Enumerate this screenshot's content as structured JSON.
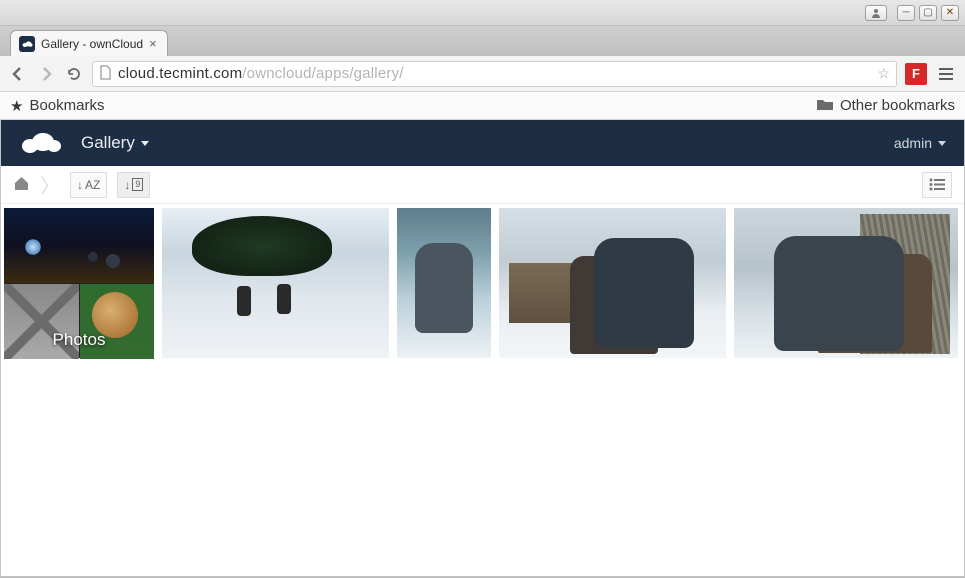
{
  "window": {
    "tab_title": "Gallery - ownCloud"
  },
  "browser": {
    "url_host": "cloud.tecmint.com",
    "url_path": "/owncloud/apps/gallery/",
    "bookmarks_label": "Bookmarks",
    "other_bookmarks_label": "Other bookmarks",
    "extension_letter": "F"
  },
  "owncloud": {
    "app_name": "Gallery",
    "user_name": "admin",
    "sort_label": "AZ",
    "date_label": "9",
    "album_label": "Photos"
  }
}
